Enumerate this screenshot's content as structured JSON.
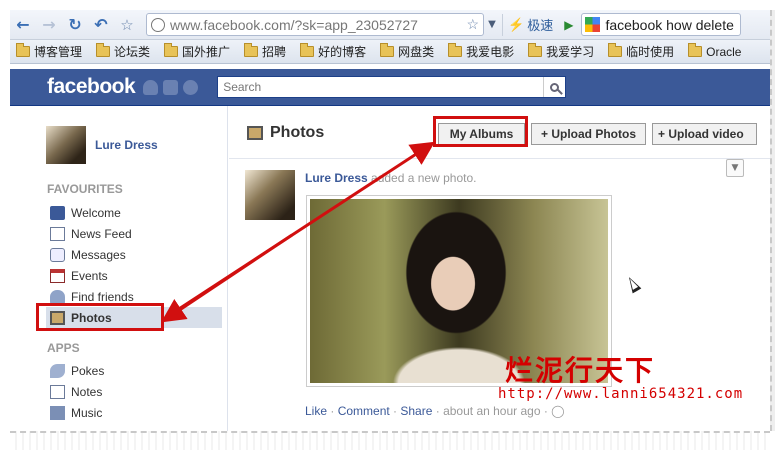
{
  "browser": {
    "url": "www.facebook.com/?sk=app_23052727",
    "speed_label": "极速",
    "search_query": "facebook how delete",
    "bookmarks": [
      "博客管理",
      "论坛类",
      "国外推广",
      "招聘",
      "好的博客",
      "网盘类",
      "我爱电影",
      "我爱学习",
      "临时使用",
      "Oracle"
    ]
  },
  "fb": {
    "logo": "facebook",
    "search_placeholder": "Search"
  },
  "profile": {
    "name": "Lure Dress"
  },
  "sidebar": {
    "favourites_header": "FAVOURITES",
    "favourites": [
      {
        "label": "Welcome",
        "icon": "welcome-icon"
      },
      {
        "label": "News Feed",
        "icon": "news-feed-icon"
      },
      {
        "label": "Messages",
        "icon": "messages-icon"
      },
      {
        "label": "Events",
        "icon": "events-icon"
      },
      {
        "label": "Find friends",
        "icon": "find-friends-icon"
      },
      {
        "label": "Photos",
        "icon": "photos-icon"
      }
    ],
    "apps_header": "APPS",
    "apps": [
      {
        "label": "Pokes",
        "icon": "pokes-icon"
      },
      {
        "label": "Notes",
        "icon": "notes-icon"
      },
      {
        "label": "Music",
        "icon": "music-icon"
      }
    ]
  },
  "main": {
    "title": "Photos",
    "buttons": {
      "my_albums": "My Albums",
      "upload_photos": "+ Upload Photos",
      "upload_video": "+ Upload video"
    },
    "story": {
      "author": "Lure Dress",
      "action": " added a new photo.",
      "like": "Like",
      "comment": "Comment",
      "share": "Share",
      "time": "about an hour ago",
      "sep": " · "
    }
  },
  "watermark": {
    "title": "烂泥行天下",
    "url": "http://www.lanni654321.com"
  },
  "colors": {
    "fb_blue": "#3b5998",
    "highlight_red": "#d10f0f"
  }
}
